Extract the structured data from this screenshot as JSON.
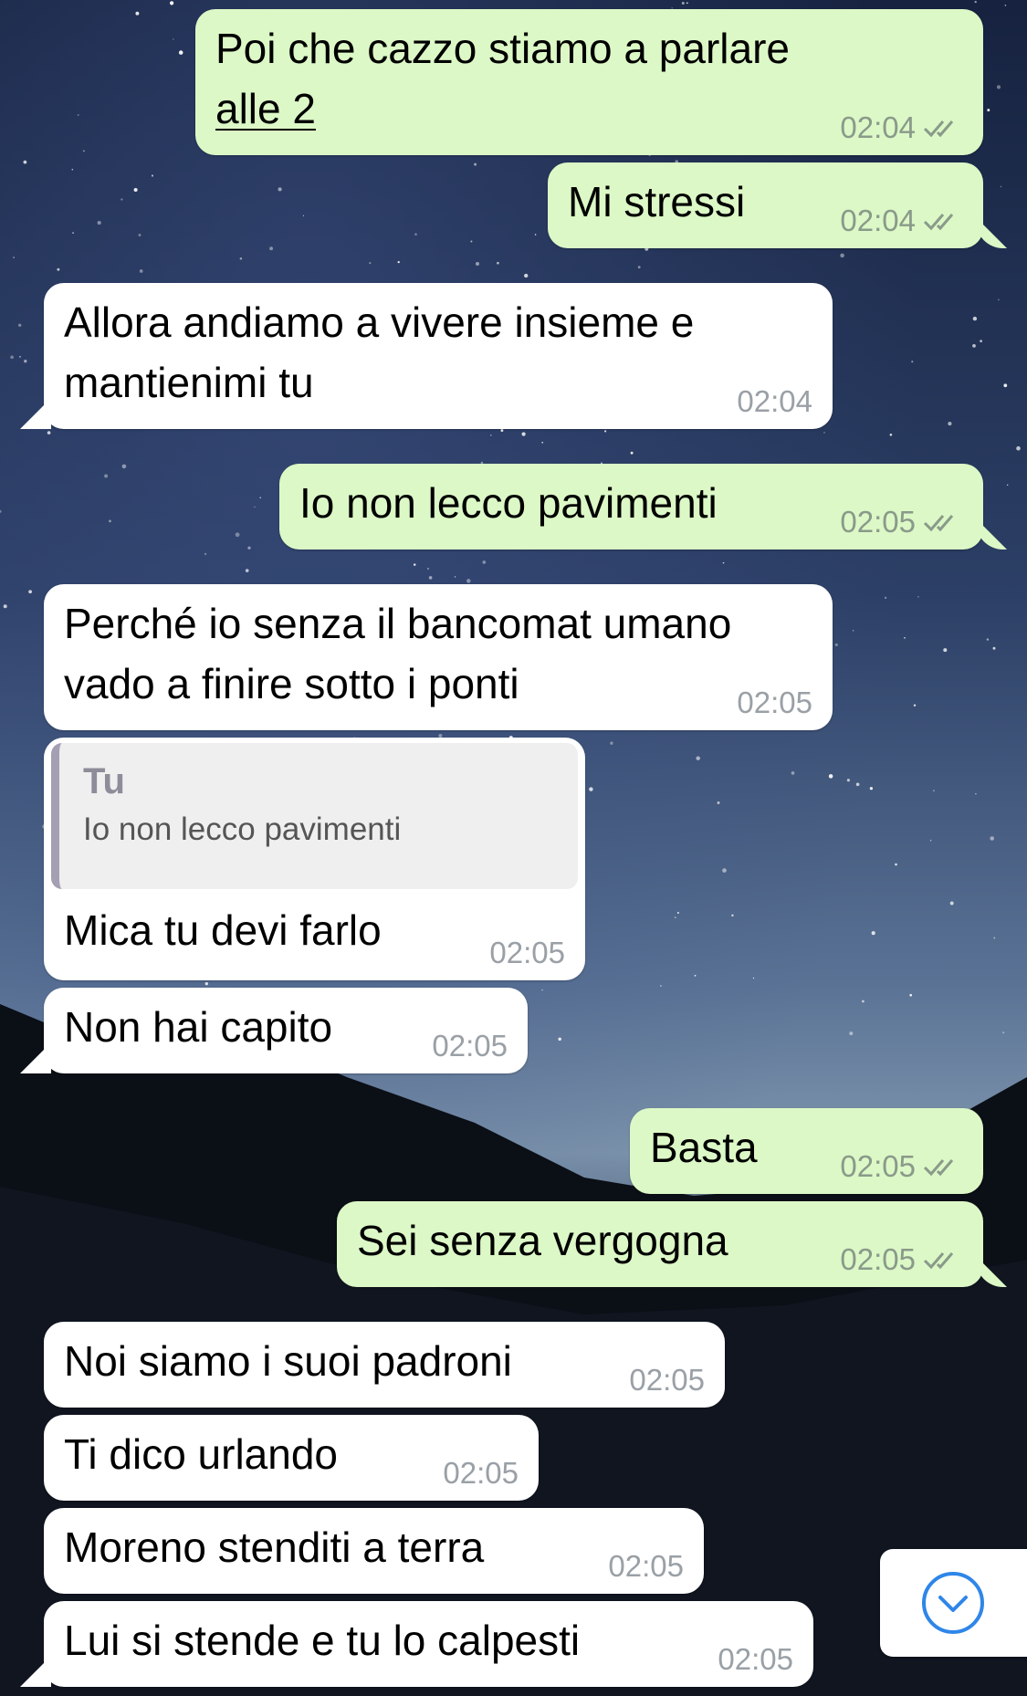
{
  "colors": {
    "outgoing_bubble": "#dcf8c6",
    "incoming_bubble": "#ffffff",
    "read_ticks": "#8a9a8a",
    "scroll_button_accent": "#2f86e8",
    "quote_bar": "#a49fb3"
  },
  "icons": {
    "read_receipt": "double-check-icon",
    "scroll_down": "chevron-down-circle-icon"
  },
  "messages": [
    {
      "direction": "out",
      "text_before": "Poi che cazzo stiamo a parlare ",
      "text_link": "alle 2",
      "time": "02:04",
      "status": "read"
    },
    {
      "direction": "out",
      "text": "Mi stressi",
      "time": "02:04",
      "status": "read"
    },
    {
      "direction": "in",
      "text": "Allora andiamo a vivere insieme e mantienimi tu",
      "time": "02:04"
    },
    {
      "direction": "out",
      "text": "Io non lecco pavimenti",
      "time": "02:05",
      "status": "read"
    },
    {
      "direction": "in",
      "text": "Perché io senza il bancomat umano vado a finire sotto i ponti",
      "time": "02:05"
    },
    {
      "direction": "in",
      "quote": {
        "author": "Tu",
        "text": "Io non lecco pavimenti"
      },
      "text": "Mica tu devi farlo",
      "time": "02:05"
    },
    {
      "direction": "in",
      "text": "Non hai capito",
      "time": "02:05"
    },
    {
      "direction": "out",
      "text": "Basta",
      "time": "02:05",
      "status": "read"
    },
    {
      "direction": "out",
      "text": "Sei senza vergogna",
      "time": "02:05",
      "status": "read"
    },
    {
      "direction": "in",
      "text": "Noi siamo i suoi padroni",
      "time": "02:05"
    },
    {
      "direction": "in",
      "text": "Ti dico urlando",
      "time": "02:05"
    },
    {
      "direction": "in",
      "text": "Moreno stenditi a terra",
      "time": "02:05"
    },
    {
      "direction": "in",
      "text": "Lui si stende e tu lo calpesti",
      "time": "02:05"
    }
  ]
}
